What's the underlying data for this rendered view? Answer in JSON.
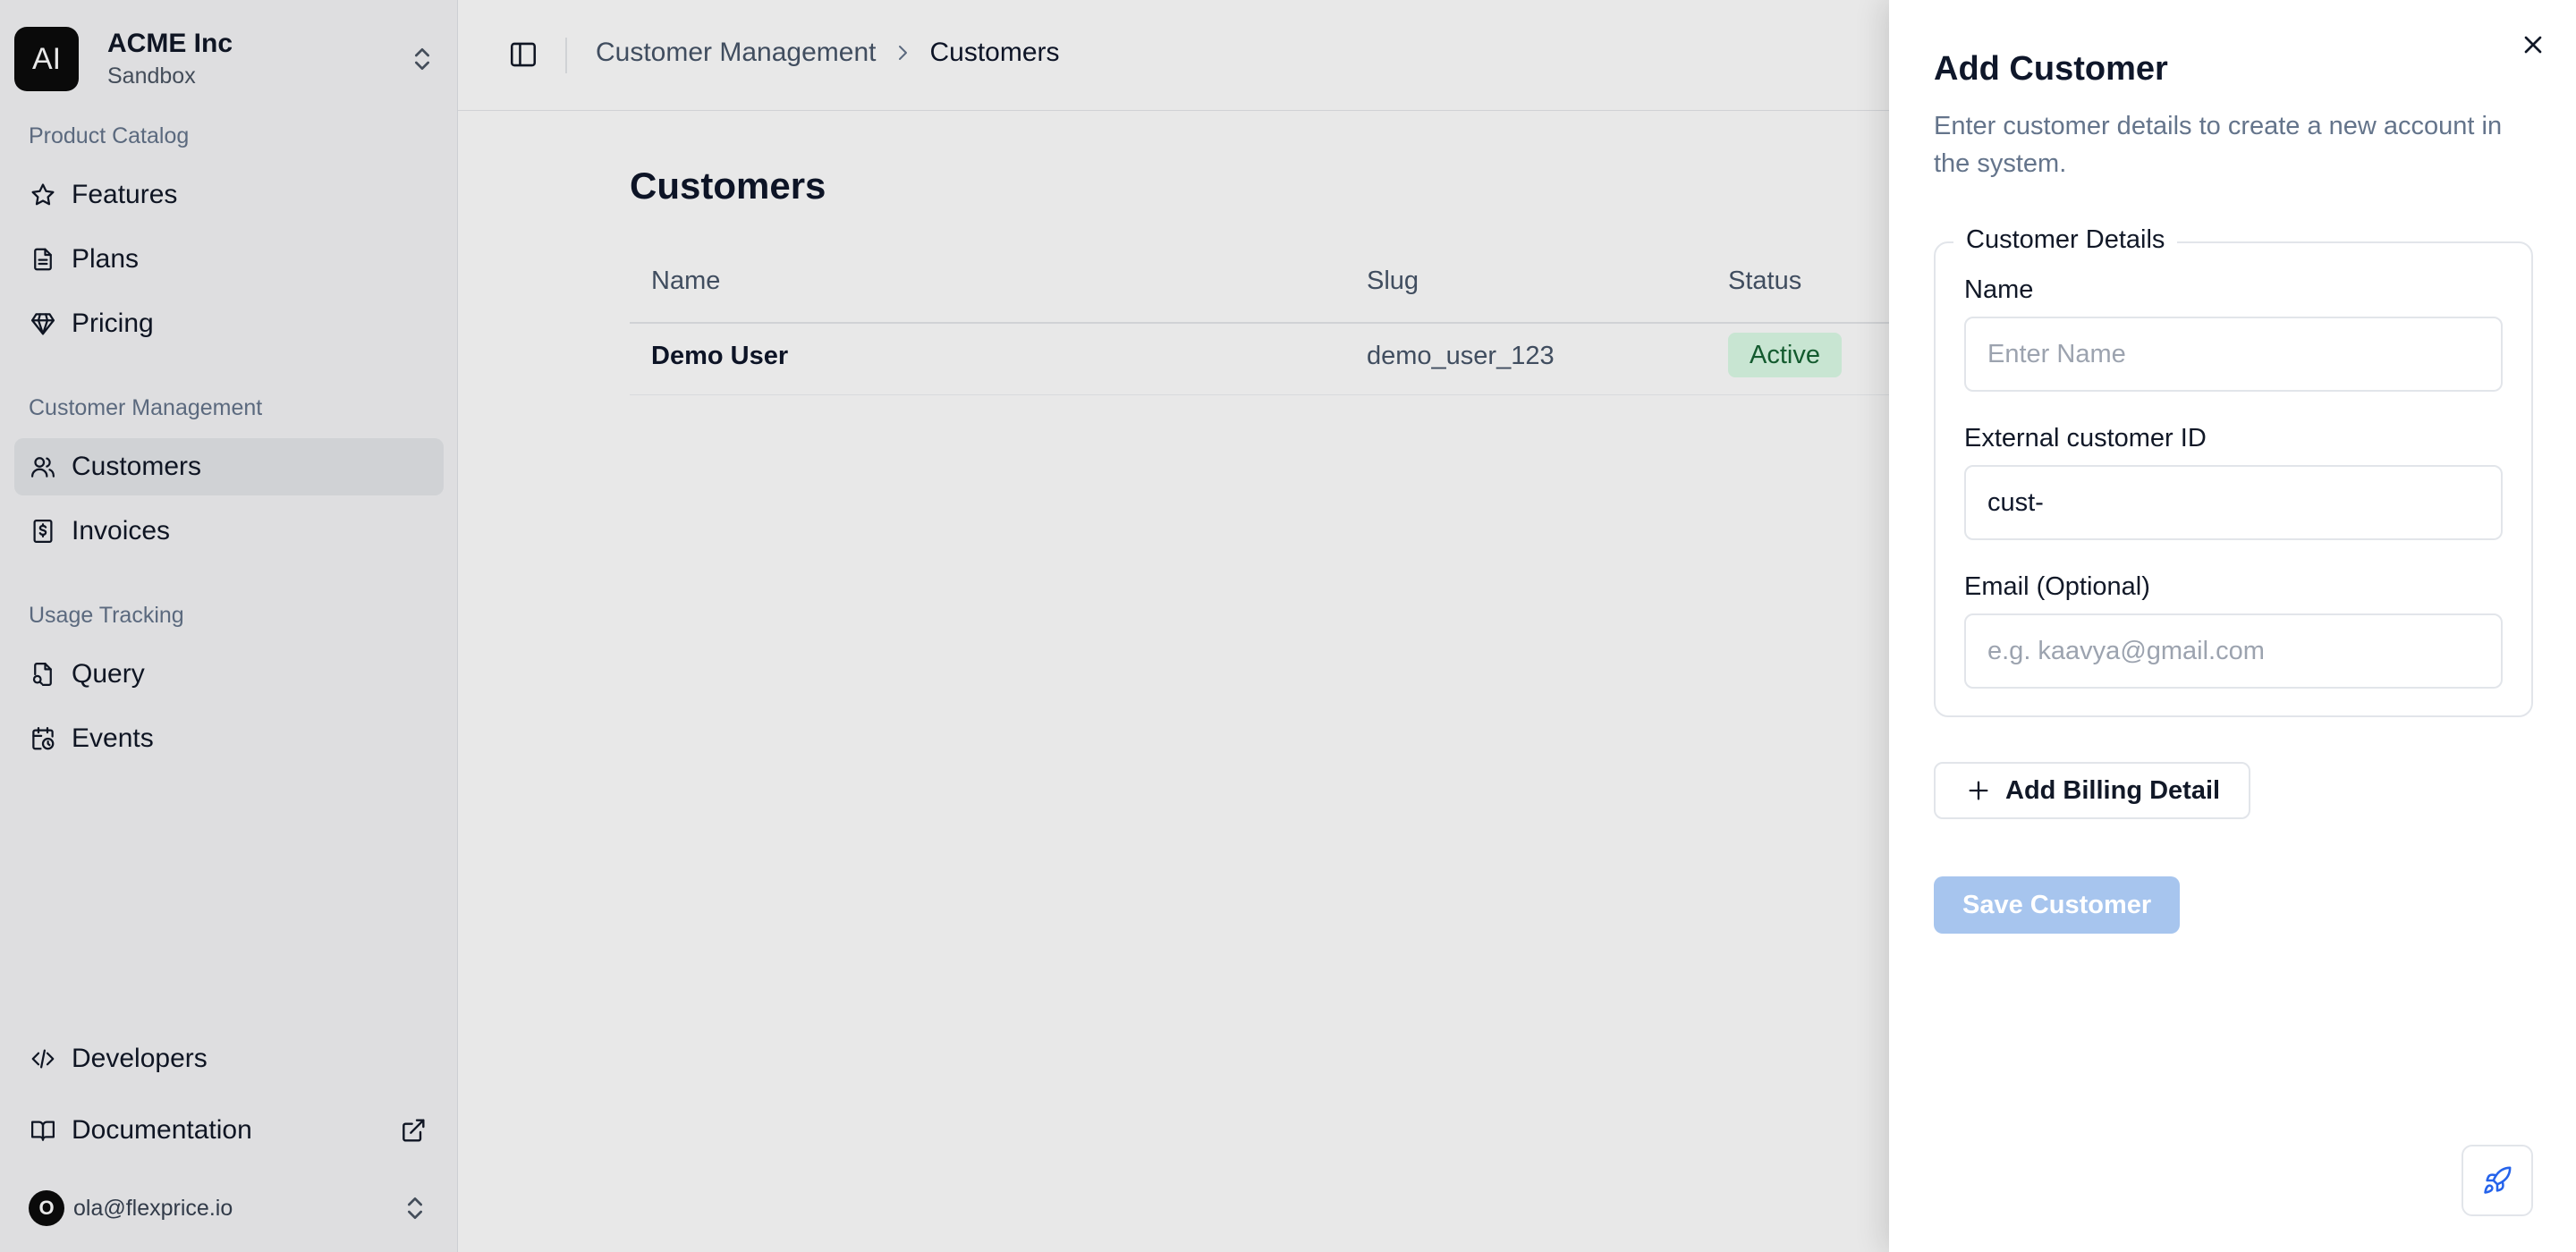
{
  "org": {
    "initials": "AI",
    "name": "ACME Inc",
    "environment": "Sandbox"
  },
  "sidebar": {
    "sections": [
      {
        "label": "Product Catalog",
        "items": [
          {
            "label": "Features",
            "icon": "star-icon"
          },
          {
            "label": "Plans",
            "icon": "document-icon"
          },
          {
            "label": "Pricing",
            "icon": "diamond-icon"
          }
        ]
      },
      {
        "label": "Customer Management",
        "items": [
          {
            "label": "Customers",
            "icon": "users-icon",
            "active": true
          },
          {
            "label": "Invoices",
            "icon": "receipt-icon"
          }
        ]
      },
      {
        "label": "Usage Tracking",
        "items": [
          {
            "label": "Query",
            "icon": "file-search-icon"
          },
          {
            "label": "Events",
            "icon": "calendar-clock-icon"
          }
        ]
      }
    ],
    "footer_items": [
      {
        "label": "Developers",
        "icon": "code-icon"
      },
      {
        "label": "Documentation",
        "icon": "book-icon",
        "external": true
      }
    ],
    "user": {
      "initial": "O",
      "email": "ola@flexprice.io"
    }
  },
  "header": {
    "breadcrumb": {
      "parent": "Customer Management",
      "current": "Customers"
    }
  },
  "main": {
    "title": "Customers",
    "table": {
      "columns": [
        "Name",
        "Slug",
        "Status"
      ],
      "rows": [
        {
          "name": "Demo User",
          "slug": "demo_user_123",
          "status": "Active"
        }
      ]
    }
  },
  "sheet": {
    "title": "Add Customer",
    "description": "Enter customer details to create a new account in the system.",
    "fieldset_legend": "Customer Details",
    "fields": {
      "name": {
        "label": "Name",
        "placeholder": "Enter Name",
        "value": ""
      },
      "external_id": {
        "label": "External customer ID",
        "placeholder": "",
        "value": "cust-"
      },
      "email": {
        "label": "Email (Optional)",
        "placeholder": "e.g. kaavya@gmail.com",
        "value": ""
      }
    },
    "add_billing_label": "Add Billing Detail",
    "save_label": "Save Customer"
  },
  "colors": {
    "accent_disabled": "#a7c5ee",
    "status_active_bg": "#dcfce7",
    "status_active_text": "#166534"
  }
}
